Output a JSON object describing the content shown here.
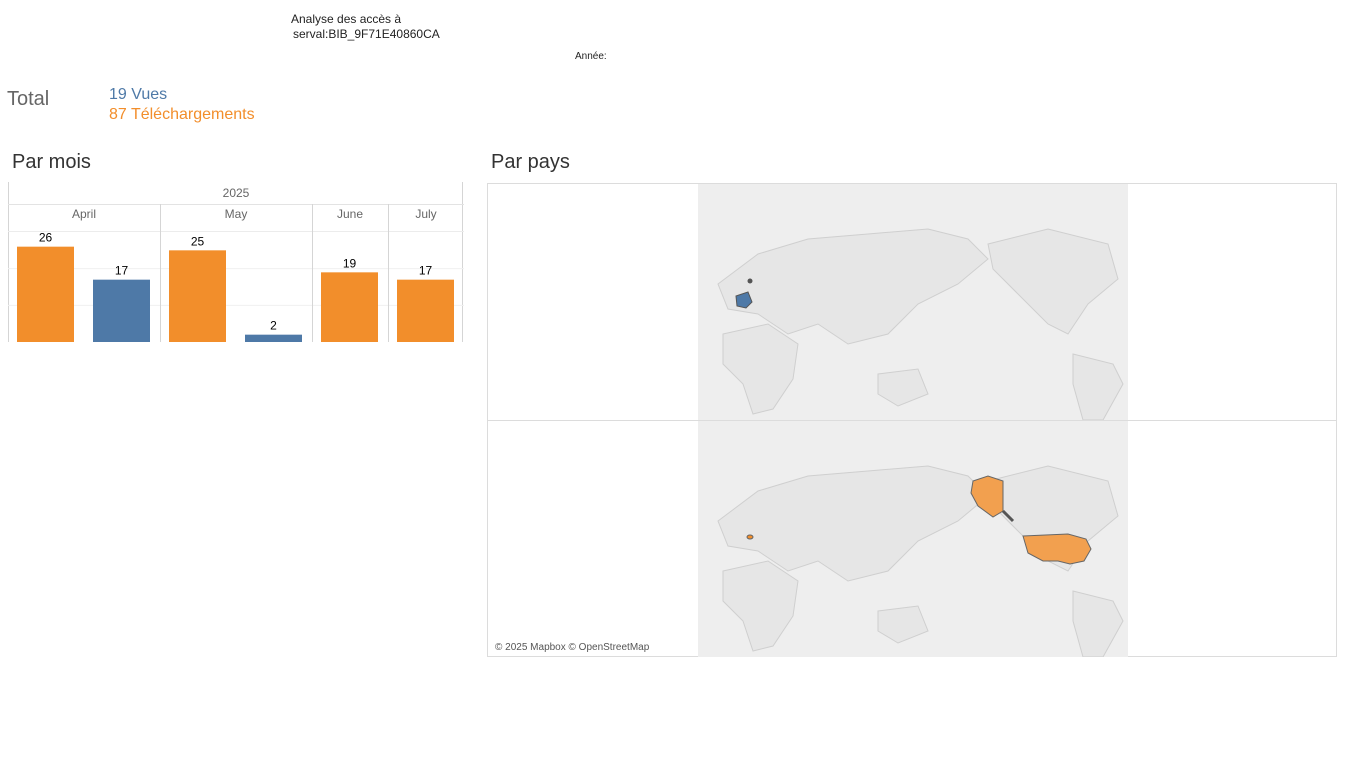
{
  "header": {
    "title_line1": "Analyse des accès à",
    "title_line2": "serval:BIB_9F71E40860CA",
    "year_label": "Année:"
  },
  "totals": {
    "label": "Total",
    "views": "19 Vues",
    "downloads": "87 Téléchargements"
  },
  "sections": {
    "by_month": "Par mois",
    "by_country": "Par pays"
  },
  "colors": {
    "views": "#4e79a7",
    "downloads": "#f28e2b",
    "land": "#e6e6e6",
    "border": "#cccccc"
  },
  "chart_data": {
    "type": "bar",
    "year": "2025",
    "categories": [
      "April",
      "May",
      "June",
      "July"
    ],
    "series": [
      {
        "color": "#f28e2b",
        "values": [
          26,
          25,
          19,
          17
        ]
      },
      {
        "color": "#4e79a7",
        "values": [
          17,
          2,
          null,
          null
        ]
      }
    ],
    "ylim": [
      0,
      30
    ],
    "grid": true
  },
  "map": {
    "credit": "© 2025 Mapbox © OpenStreetMap",
    "views_countries": [
      "France"
    ],
    "downloads_countries": [
      "United States",
      "Switzerland"
    ]
  }
}
